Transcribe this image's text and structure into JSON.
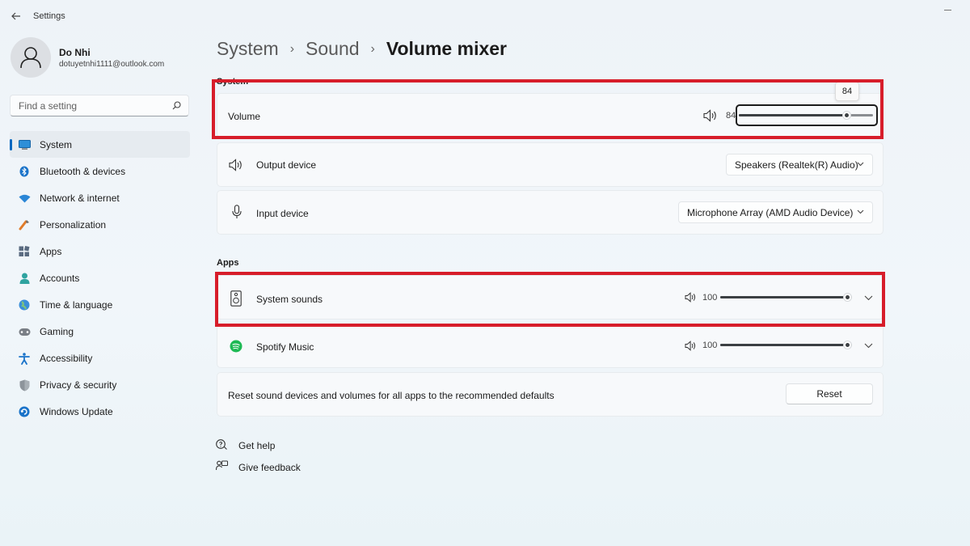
{
  "window": {
    "title": "Settings"
  },
  "profile": {
    "name": "Do Nhi",
    "email": "dotuyetnhi1111@outlook.com"
  },
  "search": {
    "placeholder": "Find a setting"
  },
  "nav": {
    "items": [
      {
        "label": "System",
        "icon": "system-icon",
        "active": true
      },
      {
        "label": "Bluetooth & devices",
        "icon": "bluetooth-icon"
      },
      {
        "label": "Network & internet",
        "icon": "wifi-icon"
      },
      {
        "label": "Personalization",
        "icon": "brush-icon"
      },
      {
        "label": "Apps",
        "icon": "apps-icon"
      },
      {
        "label": "Accounts",
        "icon": "person-icon"
      },
      {
        "label": "Time & language",
        "icon": "globe-icon"
      },
      {
        "label": "Gaming",
        "icon": "gamepad-icon"
      },
      {
        "label": "Accessibility",
        "icon": "accessibility-icon"
      },
      {
        "label": "Privacy & security",
        "icon": "shield-icon"
      },
      {
        "label": "Windows Update",
        "icon": "update-icon"
      }
    ]
  },
  "breadcrumb": {
    "items": [
      "System",
      "Sound",
      "Volume mixer"
    ]
  },
  "system_section": {
    "label": "System",
    "volume": {
      "label": "Volume",
      "value": "84",
      "level": 0.84,
      "tooltip": "84"
    },
    "output": {
      "label": "Output device",
      "selected": "Speakers (Realtek(R) Audio)"
    },
    "input": {
      "label": "Input device",
      "selected": "Microphone Array (AMD Audio Device)"
    }
  },
  "apps_section": {
    "label": "Apps",
    "apps": [
      {
        "label": "System sounds",
        "value": "100",
        "level": 1.0,
        "icon": "speaker-box-icon"
      },
      {
        "label": "Spotify Music",
        "value": "100",
        "level": 1.0,
        "icon": "spotify-icon"
      }
    ]
  },
  "reset": {
    "text": "Reset sound devices and volumes for all apps to the recommended defaults",
    "button": "Reset"
  },
  "footer": {
    "help": "Get help",
    "feedback": "Give feedback"
  },
  "colors": {
    "accent": "#0067c0",
    "highlight": "#d71d2a",
    "spotify": "#1db954"
  }
}
